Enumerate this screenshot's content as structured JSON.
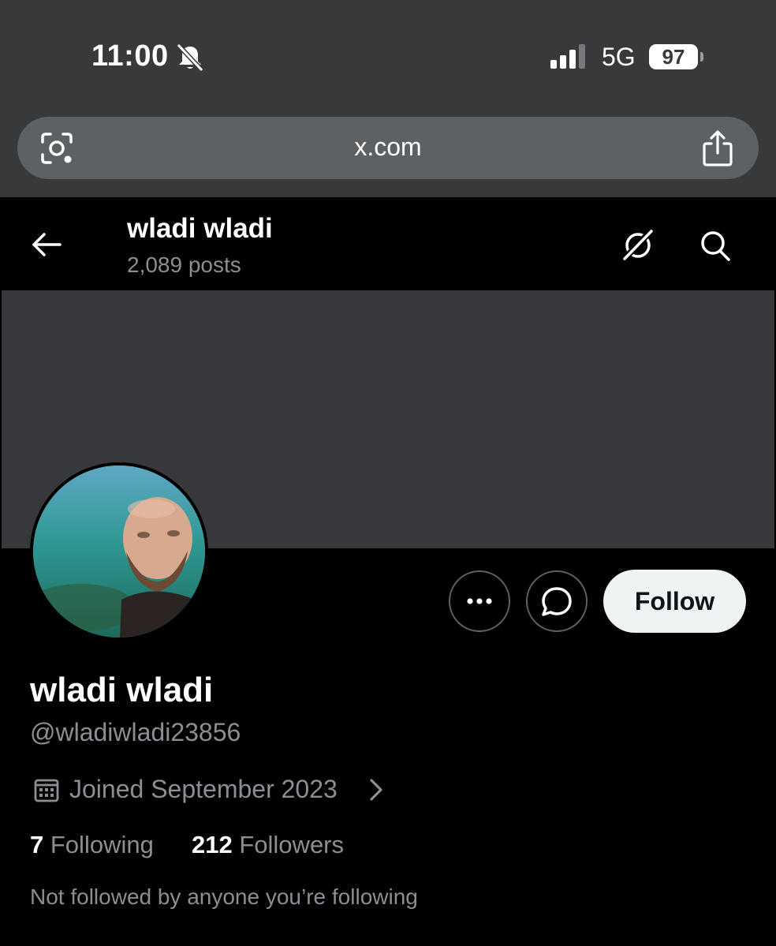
{
  "status_bar": {
    "time": "11:00",
    "network": "5G",
    "battery": "97",
    "icons": [
      "bell-off-icon",
      "signal-icon"
    ]
  },
  "browser": {
    "url": "x.com",
    "icons": [
      "camera-search-icon",
      "share-icon"
    ]
  },
  "header": {
    "name": "wladi wladi",
    "posts": "2,089 posts",
    "icons": [
      "back-arrow-icon",
      "grok-icon",
      "search-icon"
    ]
  },
  "actions": {
    "more_icon": "more-icon",
    "message_icon": "message-icon",
    "follow_label": "Follow"
  },
  "profile": {
    "display_name": "wladi wladi",
    "handle": "@wladiwladi23856",
    "joined": "Joined September 2023",
    "following_count": "7",
    "following_label": "Following",
    "followers_count": "212",
    "followers_label": "Followers",
    "mutuals_note": "Not followed by anyone you’re following"
  },
  "colors": {
    "chrome": "#38393b",
    "background": "#000000",
    "banner": "#37383c",
    "muted_text": "#8b8f93",
    "follow_button": "#eff3f4"
  }
}
